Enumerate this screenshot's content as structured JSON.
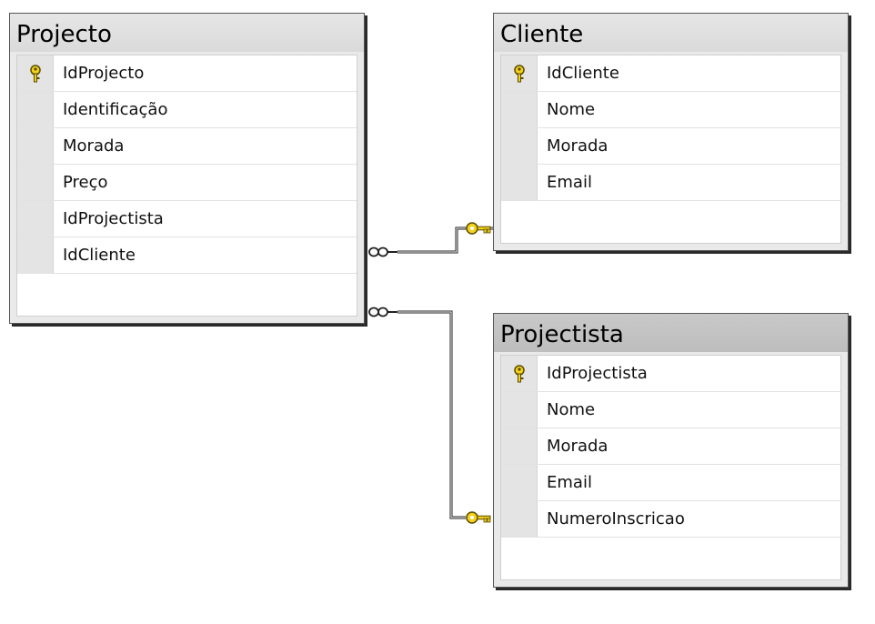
{
  "diagram": {
    "tables": [
      {
        "name": "Projecto",
        "columns": [
          {
            "name": "IdProjecto",
            "primary_key": true
          },
          {
            "name": "Identificação",
            "primary_key": false
          },
          {
            "name": "Morada",
            "primary_key": false
          },
          {
            "name": "Preço",
            "primary_key": false
          },
          {
            "name": "IdProjectista",
            "primary_key": false
          },
          {
            "name": "IdCliente",
            "primary_key": false
          }
        ]
      },
      {
        "name": "Cliente",
        "columns": [
          {
            "name": "IdCliente",
            "primary_key": true
          },
          {
            "name": "Nome",
            "primary_key": false
          },
          {
            "name": "Morada",
            "primary_key": false
          },
          {
            "name": "Email",
            "primary_key": false
          }
        ]
      },
      {
        "name": "Projectista",
        "columns": [
          {
            "name": "IdProjectista",
            "primary_key": true
          },
          {
            "name": "Nome",
            "primary_key": false
          },
          {
            "name": "Morada",
            "primary_key": false
          },
          {
            "name": "Email",
            "primary_key": false
          },
          {
            "name": "NumeroInscricao",
            "primary_key": false
          }
        ]
      }
    ],
    "relationships": [
      {
        "from": "Projecto",
        "to": "Cliente",
        "from_end": "many",
        "to_end": "one"
      },
      {
        "from": "Projecto",
        "to": "Projectista",
        "from_end": "many",
        "to_end": "one"
      }
    ],
    "colors": {
      "key_icon": "#f3d21c",
      "connector": "#222222",
      "title_dark": "#bdbdbd"
    }
  }
}
